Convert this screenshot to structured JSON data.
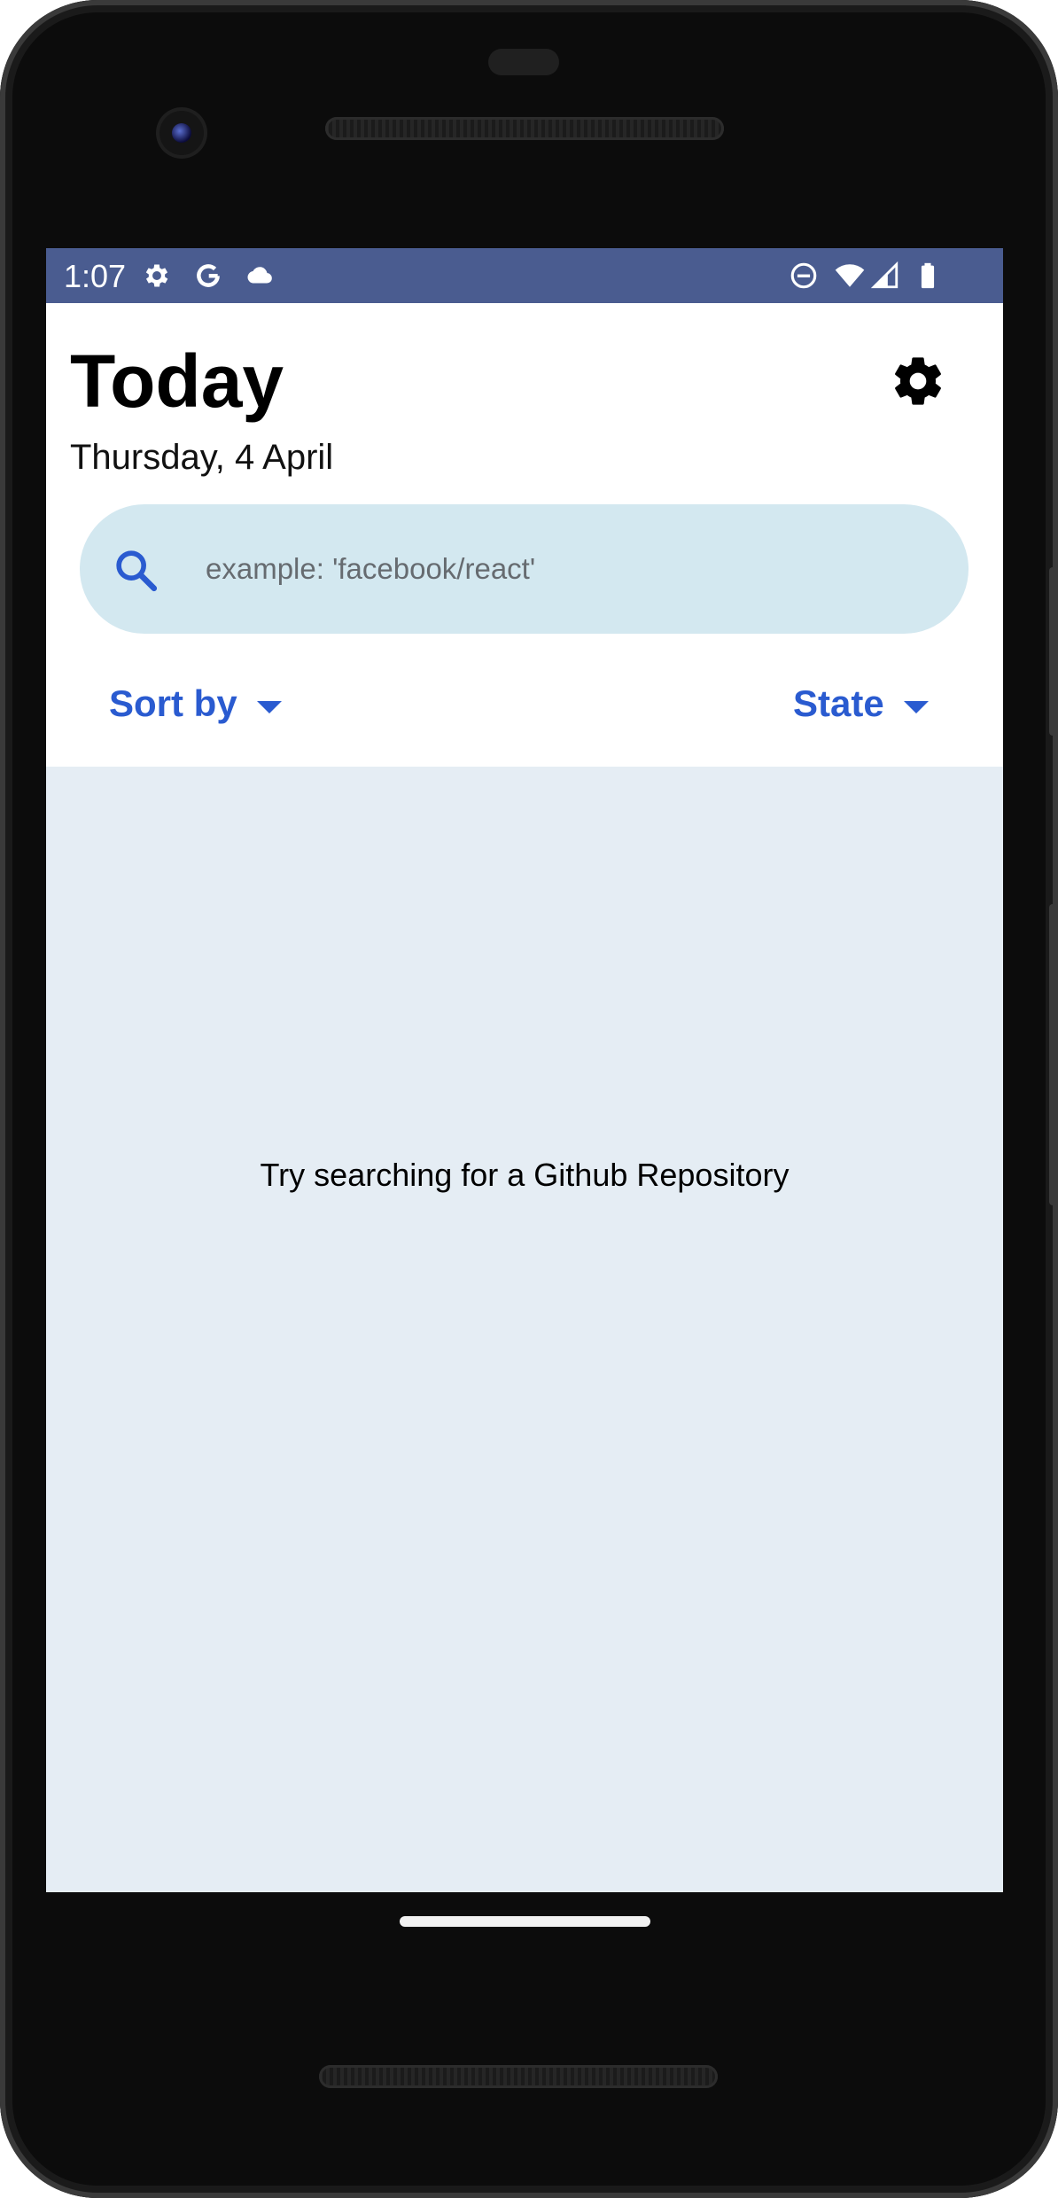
{
  "status_bar": {
    "time": "1:07",
    "left_icons": [
      "gear-icon",
      "google-icon",
      "cloud-icon"
    ],
    "right_icons": [
      "do-not-disturb-icon",
      "wifi-icon",
      "signal-icon",
      "battery-icon"
    ],
    "background_color": "#4a5c90"
  },
  "header": {
    "title": "Today",
    "date": "Thursday, 4 April",
    "settings_icon": "gear-icon"
  },
  "search": {
    "icon": "search-icon",
    "placeholder": "example: 'facebook/react'",
    "value": "",
    "background_color": "#d3e8f0"
  },
  "filters": {
    "sort_label": "Sort by",
    "state_label": "State",
    "accent_color": "#2a5bd0"
  },
  "content": {
    "empty_message": "Try searching for a Github Repository",
    "background_color": "#e5edf4"
  }
}
